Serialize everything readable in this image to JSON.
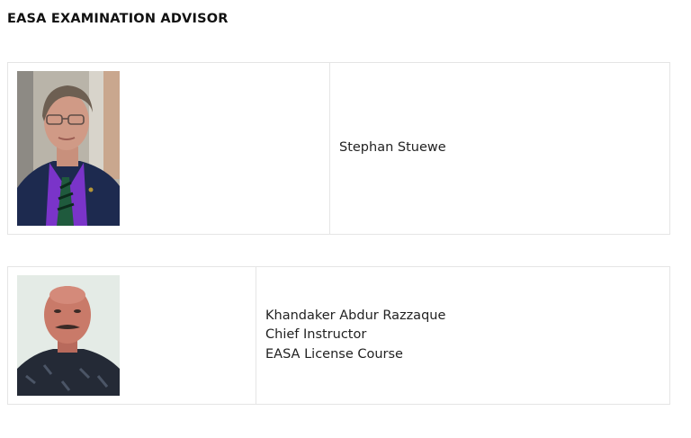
{
  "page": {
    "title": "EASA EXAMINATION ADVISOR"
  },
  "advisors": [
    {
      "photo": "portrait-photo-stephan-stuewe",
      "name": "Stephan Stuewe"
    },
    {
      "photo": "portrait-photo-khandaker-abdur-razzaque",
      "name": "Khandaker Abdur Razzaque",
      "role": "Chief Instructor",
      "course": "EASA License Course"
    }
  ]
}
